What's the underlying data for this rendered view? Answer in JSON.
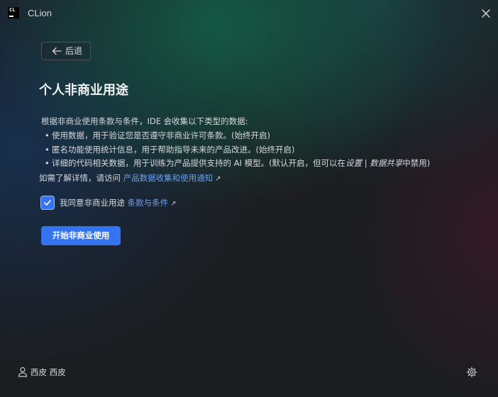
{
  "window": {
    "title": "CLion",
    "logo_text": "CL"
  },
  "back": {
    "label": "后退"
  },
  "page": {
    "title": "个人非商业用途",
    "intro": "根据非商业使用条款与条件，IDE 会收集以下类型的数据:",
    "bullets": [
      {
        "text": "使用数据，用于验证您是否遵守非商业许可条款。(始终开启)"
      },
      {
        "text": "匿名功能使用统计信息，用于帮助指导未来的产品改进。(始终开启)"
      },
      {
        "text_before": "详细的代码相关数据，用于训练为产品提供支持的 AI 模型。(默认开启，但可以在",
        "italic": "设置 | 数据共享",
        "text_after": "中禁用)"
      }
    ],
    "more_info_prefix": "如需了解详情，请访问",
    "more_info_link": "产品数据收集和使用通知"
  },
  "agreement": {
    "checked": true,
    "label": "我同意非商业用途",
    "terms_link": "条款与条件"
  },
  "start_button": {
    "label": "开始非商业使用"
  },
  "footer": {
    "user_name": "西皮 西皮"
  },
  "colors": {
    "accent": "#3574f0",
    "link": "#6c9ff2",
    "text": "#d7d9dd",
    "title": "#f0f1f3"
  },
  "icons": {
    "close": "close-icon",
    "back": "arrow-left-icon",
    "external": "external-link-icon",
    "check": "checkmark-icon",
    "user": "user-icon",
    "settings": "gear-icon"
  }
}
